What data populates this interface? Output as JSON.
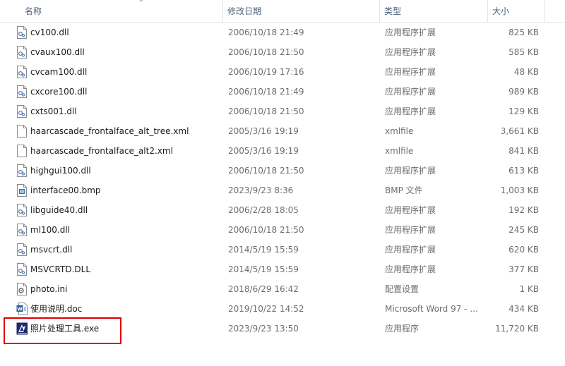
{
  "columns": {
    "name": "名称",
    "modified": "修改日期",
    "type": "类型",
    "size": "大小"
  },
  "sort_indicator": "^",
  "files": [
    {
      "icon": "dll-file-icon",
      "name": "cv100.dll",
      "modified": "2006/10/18 21:49",
      "type": "应用程序扩展",
      "size": "825 KB"
    },
    {
      "icon": "dll-file-icon",
      "name": "cvaux100.dll",
      "modified": "2006/10/18 21:50",
      "type": "应用程序扩展",
      "size": "585 KB"
    },
    {
      "icon": "dll-file-icon",
      "name": "cvcam100.dll",
      "modified": "2006/10/19 17:16",
      "type": "应用程序扩展",
      "size": "48 KB"
    },
    {
      "icon": "dll-file-icon",
      "name": "cxcore100.dll",
      "modified": "2006/10/18 21:49",
      "type": "应用程序扩展",
      "size": "989 KB"
    },
    {
      "icon": "dll-file-icon",
      "name": "cxts001.dll",
      "modified": "2006/10/18 21:50",
      "type": "应用程序扩展",
      "size": "129 KB"
    },
    {
      "icon": "xml-file-icon",
      "name": "haarcascade_frontalface_alt_tree.xml",
      "modified": "2005/3/16 19:19",
      "type": "xmlfile",
      "size": "3,661 KB"
    },
    {
      "icon": "xml-file-icon",
      "name": "haarcascade_frontalface_alt2.xml",
      "modified": "2005/3/16 19:19",
      "type": "xmlfile",
      "size": "841 KB"
    },
    {
      "icon": "dll-file-icon",
      "name": "highgui100.dll",
      "modified": "2006/10/18 21:50",
      "type": "应用程序扩展",
      "size": "613 KB"
    },
    {
      "icon": "bmp-file-icon",
      "name": "interface00.bmp",
      "modified": "2023/9/23 8:36",
      "type": "BMP 文件",
      "size": "1,003 KB"
    },
    {
      "icon": "dll-file-icon",
      "name": "libguide40.dll",
      "modified": "2006/2/28 18:05",
      "type": "应用程序扩展",
      "size": "192 KB"
    },
    {
      "icon": "dll-file-icon",
      "name": "ml100.dll",
      "modified": "2006/10/18 21:50",
      "type": "应用程序扩展",
      "size": "245 KB"
    },
    {
      "icon": "dll-file-icon",
      "name": "msvcrt.dll",
      "modified": "2014/5/19 15:59",
      "type": "应用程序扩展",
      "size": "620 KB"
    },
    {
      "icon": "dll-file-icon",
      "name": "MSVCRTD.DLL",
      "modified": "2014/5/19 15:59",
      "type": "应用程序扩展",
      "size": "377 KB"
    },
    {
      "icon": "ini-file-icon",
      "name": "photo.ini",
      "modified": "2018/6/29 16:42",
      "type": "配置设置",
      "size": "1 KB"
    },
    {
      "icon": "word-doc-icon",
      "name": "使用说明.doc",
      "modified": "2019/10/22 14:52",
      "type": "Microsoft Word 97 - ...",
      "size": "434 KB"
    },
    {
      "icon": "exe-app-icon",
      "name": "照片处理工具.exe",
      "modified": "2023/9/23 13:50",
      "type": "应用程序",
      "size": "11,720 KB"
    }
  ],
  "colors": {
    "header_text": "#4c607a",
    "highlight_border": "#e00000",
    "secondary_text": "#6d6d6d"
  }
}
